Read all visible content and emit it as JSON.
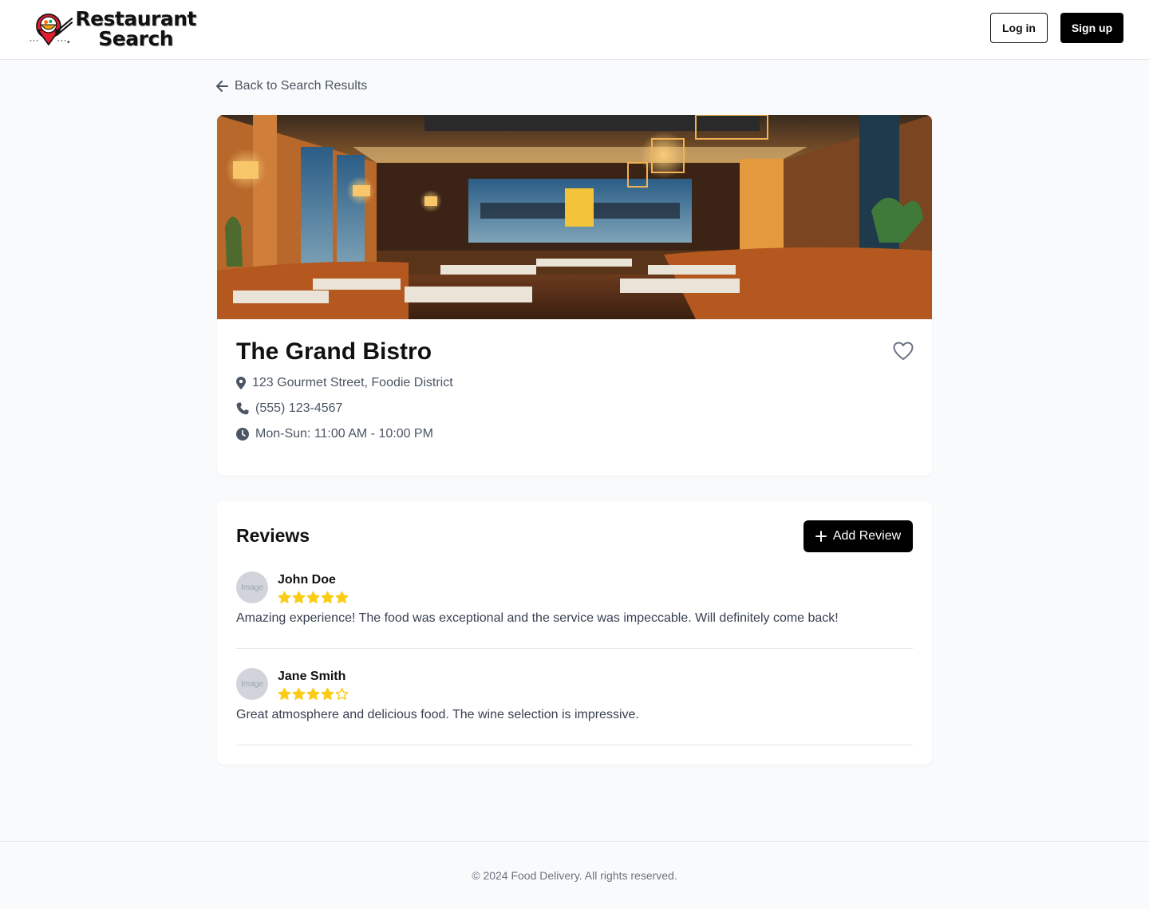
{
  "header": {
    "logo_line1": "Restaurant",
    "logo_line2": "Search",
    "login_label": "Log in",
    "signup_label": "Sign up"
  },
  "back_link": {
    "label": "Back to Search Results",
    "icon": "arrow-left-icon"
  },
  "restaurant": {
    "name": "The Grand Bistro",
    "address": "123 Gourmet Street, Foodie District",
    "phone": "(555) 123-4567",
    "hours": "Mon-Sun: 11:00 AM - 10:00 PM",
    "favorite_icon": "heart-outline-icon"
  },
  "reviews": {
    "title": "Reviews",
    "add_label": "Add Review",
    "items": [
      {
        "avatar_text": "Image",
        "name": "John Doe",
        "rating": 5,
        "max_rating": 5,
        "text": "Amazing experience! The food was exceptional and the service was impeccable. Will definitely come back!"
      },
      {
        "avatar_text": "Image",
        "name": "Jane Smith",
        "rating": 4,
        "max_rating": 5,
        "text": "Great atmosphere and delicious food. The wine selection is impressive."
      }
    ]
  },
  "footer": {
    "copyright": "© 2024 Food Delivery. All rights reserved."
  },
  "colors": {
    "star": "#facc15",
    "primary_button": "#000000",
    "page_background": "#f9fafb",
    "muted_text": "#4b5563"
  }
}
